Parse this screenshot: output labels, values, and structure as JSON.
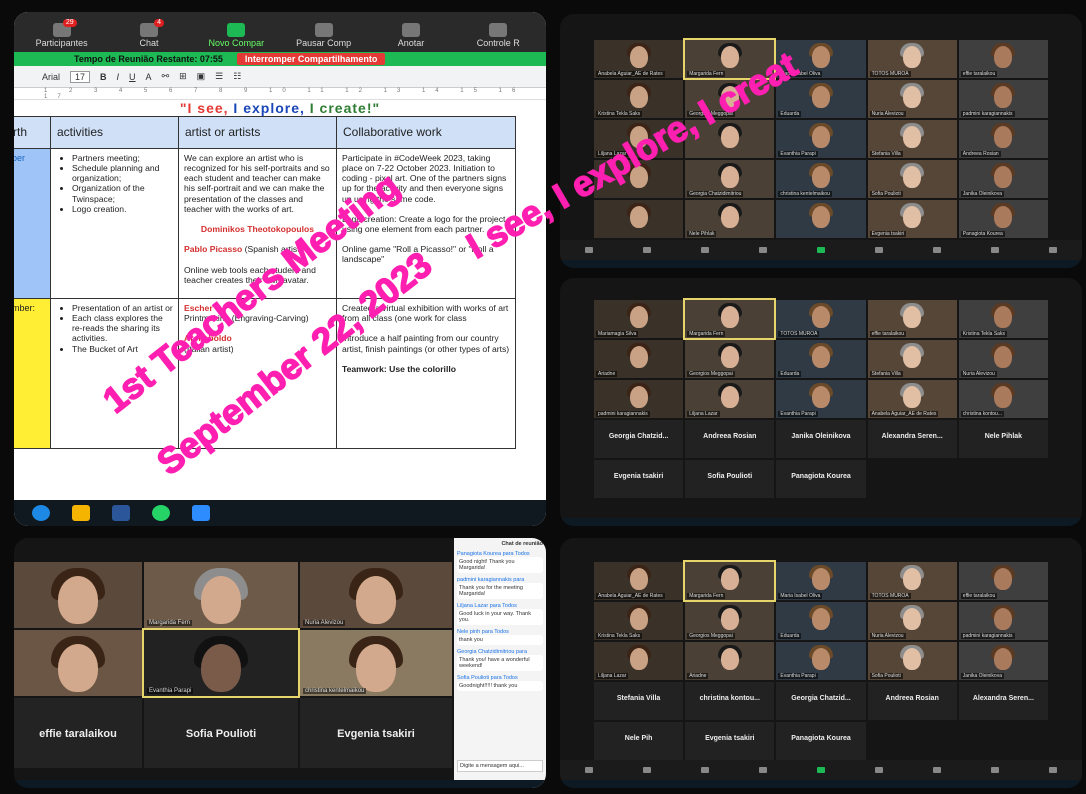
{
  "share_toolbar": {
    "participants_count": "29",
    "chat_badge": "4",
    "items": [
      "Participantes",
      "Chat",
      "Novo Compar",
      "Pausar Comp",
      "Anotar",
      "Controle R"
    ],
    "time_left": "Tempo de Reunião Restante: 07:55",
    "stop_share": "Interromper Compartilhamento"
  },
  "doc": {
    "font": "Arial",
    "font_size": "17",
    "title_parts": [
      "\"I see, ",
      "I explore, ",
      "I create!\""
    ],
    "headers": [
      "rth",
      "activities",
      "artist or artists",
      "Collaborative work"
    ],
    "row1": {
      "month": "ber",
      "activities": [
        "Partners meeting;",
        "Schedule planning and organization;",
        "Organization of the Twinspace;",
        "Logo creation."
      ],
      "artists_text": "We can explore an artist who is recognized for his self-portraits and so each student and teacher can make his self-portrait and we can make the presentation of the classes and teacher with the works of art.",
      "artist1": "Dominikos Theotokopoulos",
      "artist2": "Pablo Picasso",
      "artist2_note": "(Spanish artist)",
      "artists_text2": "Online web tools each student and teacher creates their own avatar.",
      "collab1": "Participate in #CodeWeek 2023, taking place on 7-22 October 2023. Initiation to coding - pixel art. One of the partners signs up for the activity and then everyone signs up using the same code.",
      "collab2": "Logo creation: Create a logo for the project using one element from each partner.",
      "collab3": "Online game \"Roll a Picasso!\" or \"Roll a landscape\""
    },
    "row2": {
      "month": "mber:",
      "activities": [
        "Presentation of an artist or",
        "Each class explores the re-reads the sharing its activities.",
        "The Bucket of Art"
      ],
      "artist1": "Escher",
      "artists_text": "Printmaking (Engraving-Carving)",
      "artist2": "Arcimboldo",
      "artist2_note": "(Italian artist)",
      "collab1": "Created a virtual exhibition with works of art from all class (one work for class",
      "collab2": "Introduce a half painting from our country artist, finish paintings (or other types of arts)",
      "collab3": "Teamwork: Use the colorillo"
    }
  },
  "overlay": {
    "line1": "1st Teachers Meeting",
    "line2": "September 22, 2023",
    "line3": "I see, I explore, I creat"
  },
  "gallery_top": {
    "tiles": [
      "Anabela Aguiar_AE de Rates",
      "Margarida Fern",
      "Maria Isabel Oliva",
      "TOTOS MUROA",
      "effie taralaikou",
      "Kristina Tekla Saks",
      "Georgios Meggopai",
      "Eduarda",
      "Nuria Alevizou",
      "padmini karagiannakis",
      "Liljana Lazar",
      "",
      "Evanthia Parapi",
      "Stefania Villa",
      "Andreea Rosian",
      "",
      "Georgia Chatzidimitriou",
      "christina kentelmaikou",
      "Sofia Poulioti",
      "Janika Oleinikova",
      "",
      "Nele Pihlak",
      "",
      "Evgenia tsakiri",
      "Panagiota Kourea"
    ],
    "name_tiles": [
      "Sofia Poulioti",
      "Janika Oleinikova",
      "Nele Pihlak",
      "Evgenia tsakiri",
      "Panagiota Kourea"
    ]
  },
  "gallery_mid": {
    "tiles": [
      "Mariamagia Silva",
      "Margarida Fern",
      "TOTOS MUROA",
      "effie taralaikou",
      "Kristina Tekla Saks",
      "Ariadne",
      "Georgios Meggopai",
      "Eduarda",
      "Stefania Villa",
      "Nuria Alevizou",
      "padmini karagiannakis",
      "Liljana Lazar",
      "Evanthia Parapi",
      "Anabela Aguiar_AE de Rates",
      "christina kontou..."
    ],
    "name_tiles": [
      "Georgia Chatzid...",
      "Andreea Rosian",
      "Janika Oleinikova",
      "Alexandra Seren...",
      "Nele Pihlak",
      "Evgenia tsakiri",
      "Sofia Poulioti",
      "Panagiota Kourea"
    ]
  },
  "gallery_bot": {
    "tiles": [
      "Anabela Aguiar_AE de Rates",
      "Margarida Fern",
      "Maria Isabel Oliva",
      "TOTOS MUROA",
      "effie taralaikou",
      "Kristina Tekla Saks",
      "Georgios Meggopai",
      "Eduarda",
      "Nuria Alevizou",
      "padmini karagiannakis",
      "Liljana Lazar",
      "Ariadne",
      "Evanthia Parapi",
      "Sofia Poulioti",
      "Janika Oleinikova"
    ],
    "name_tiles": [
      "Stefania Villa",
      "christina kontou...",
      "Georgia Chatzid...",
      "Andreea Rosian",
      "Alexandra Seren...",
      "Nele Pih",
      "Evgenia tsakiri",
      "Panagiota Kourea"
    ]
  },
  "speaker_view": {
    "tiles": [
      "Margarida Fern",
      "Nuria Alevizou",
      "Evanthia Parapi",
      "christina kentelmaikou"
    ],
    "name_tiles": [
      "effie taralaikou",
      "Sofia Poulioti",
      "Evgenia tsakiri"
    ],
    "chat_title": "Chat de reunião",
    "messages": [
      {
        "from": "Panagiota Kourea para Todos",
        "text": "Good night! Thank you Margarida!"
      },
      {
        "from": "padmini karagiannakis para",
        "text": "Thank you for the meeting Margarida!"
      },
      {
        "from": "Liljana Lazar para Todos",
        "text": "Good luck in your way. Thank you."
      },
      {
        "from": "Nele pinh para Todos",
        "text": "thank you"
      },
      {
        "from": "Georgia Chatzidimitriou para",
        "text": "Thank you! have a wonderful weekend!"
      },
      {
        "from": "Sofia Poulioti para Todos",
        "text": "Goodnight!!!!! thank you"
      }
    ],
    "chat_input": "Digite a mensagem aqui..."
  }
}
